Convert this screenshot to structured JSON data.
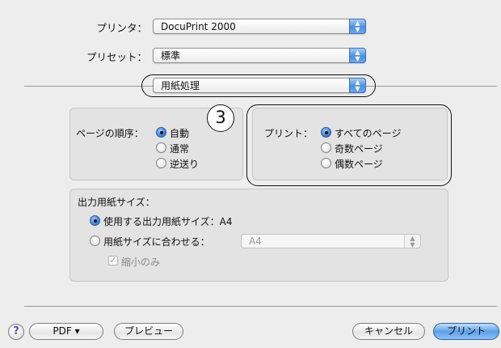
{
  "printer": {
    "label": "プリンタ：",
    "value": "DocuPrint 2000"
  },
  "presets": {
    "label": "プリセット：",
    "value": "標準"
  },
  "panel_menu": {
    "value": "用紙処理"
  },
  "page_order": {
    "label": "ページの順序：",
    "options": [
      "自動",
      "通常",
      "逆送り"
    ],
    "selected": 0
  },
  "print_pages": {
    "label": "プリント：",
    "options": [
      "すべてのページ",
      "奇数ページ",
      "偶数ページ"
    ],
    "selected": 0
  },
  "callout": "3",
  "paper_size": {
    "title": "出力用紙サイズ：",
    "option_use": "使用する出力用紙サイズ：",
    "use_value": "A4",
    "option_fit": "用紙サイズに合わせる：",
    "fit_value": "A4",
    "scale_down_only": "縮小のみ"
  },
  "footer": {
    "help": "?",
    "pdf": "PDF ▾",
    "preview": "プレビュー",
    "cancel": "キャンセル",
    "print": "プリント"
  },
  "icons": {
    "popup_arrows": "⬍",
    "check": "✓"
  }
}
